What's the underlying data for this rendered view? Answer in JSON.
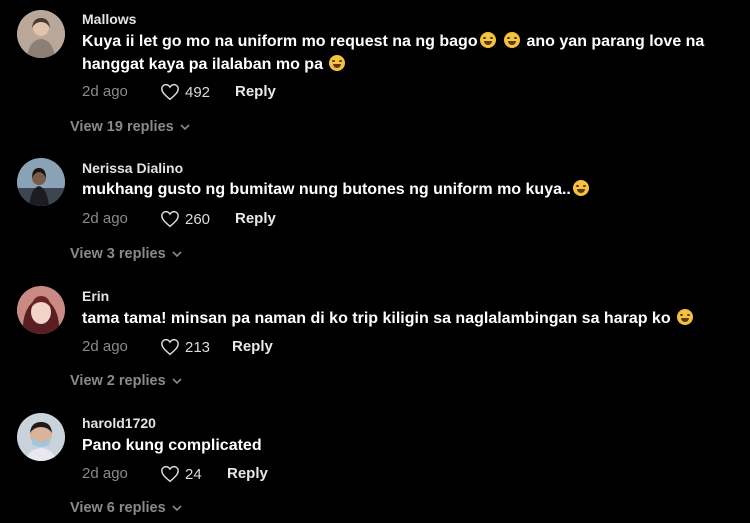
{
  "comments": [
    {
      "username": "Mallows",
      "text_parts": [
        "Kuya ii let go mo na uniform mo request na ng bago",
        "ano yan parang love na",
        "hanggat kaya pa ilalaban mo pa"
      ],
      "time": "2d ago",
      "likes": "492",
      "reply_label": "Reply",
      "view_replies": "View 19 replies"
    },
    {
      "username": "Nerissa Dialino",
      "text": "mukhang gusto ng bumitaw nung butones ng uniform mo kuya..",
      "time": "2d ago",
      "likes": "260",
      "reply_label": "Reply",
      "view_replies": "View 3 replies"
    },
    {
      "username": "Erin",
      "text": "tama tama! minsan pa naman di ko trip kiligin sa naglalambingan sa harap ko",
      "time": "2d ago",
      "likes": "213",
      "reply_label": "Reply",
      "view_replies": "View 2 replies"
    },
    {
      "username": "harold1720",
      "text": "Pano kung complicated",
      "time": "2d ago",
      "likes": "24",
      "reply_label": "Reply",
      "view_replies": "View 6 replies"
    }
  ],
  "colors": {
    "background": "#000000",
    "secondary_text": "#8a8a8a",
    "emoji": "#f6c23e"
  }
}
